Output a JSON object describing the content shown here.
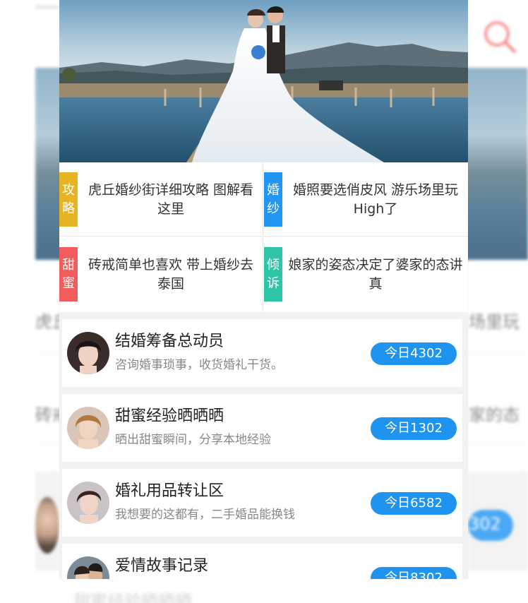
{
  "articles": [
    {
      "tag": [
        "攻",
        "略"
      ],
      "tag_color": "#e6b422",
      "title": "虎丘婚纱街详细攻略 图解看这里"
    },
    {
      "tag": [
        "婚",
        "纱"
      ],
      "tag_color": "#2196f3",
      "title": "婚照要选俏皮风 游乐场里玩High了"
    },
    {
      "tag": [
        "甜",
        "蜜"
      ],
      "tag_color": "#f25c5c",
      "title": "砖戒简单也喜欢 带上婚纱去泰国"
    },
    {
      "tag": [
        "倾",
        "诉"
      ],
      "tag_color": "#2ec4a6",
      "title": "娘家的姿态决定了婆家的态讲真"
    }
  ],
  "forums": [
    {
      "title": "结婚筹备总动员",
      "desc": "咨询婚事琐事，收货婚礼干货。",
      "badge": "今日4302"
    },
    {
      "title": "甜蜜经验晒晒晒",
      "desc": "晒出甜蜜瞬间，分享本地经验",
      "badge": "今日1302"
    },
    {
      "title": "婚礼用品转让区",
      "desc": "我想要的这都有，二手婚品能换钱",
      "badge": "今日6582"
    },
    {
      "title": "爱情故事记录",
      "desc": "",
      "badge": "今日8302"
    }
  ],
  "background": {
    "text_left_1": "虎丘",
    "text_right_1": "场里玩",
    "text_left_2": "砖戒",
    "text_right_2": "家的态",
    "badge_fragment": "302",
    "bottom_fragment": "甜蜜经验晒晒晒"
  },
  "icons": {
    "search": "search-icon"
  },
  "colors": {
    "accent": "#1e94f0",
    "search_icon": "#f26b6b"
  }
}
